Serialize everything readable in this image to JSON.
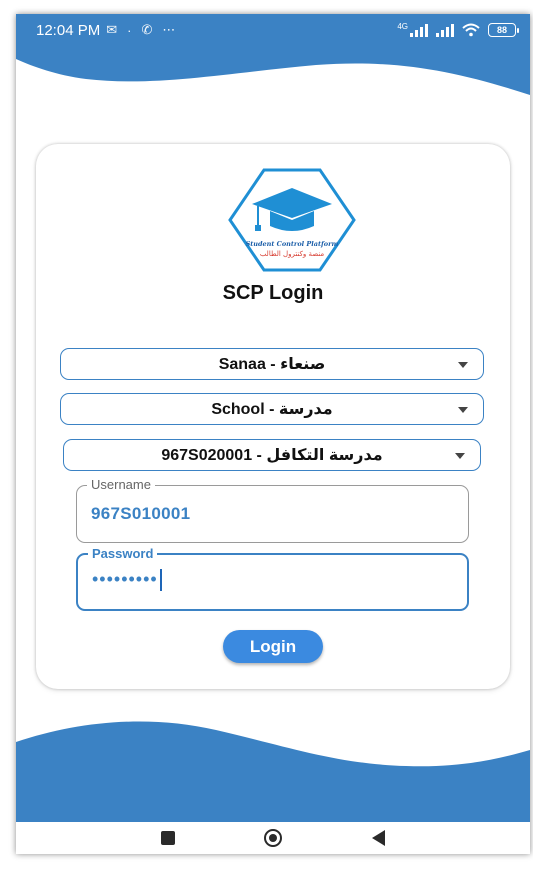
{
  "status_bar": {
    "time": "12:04 PM",
    "left_icons": [
      "mail-icon",
      "dot-icon",
      "whatsapp-icon",
      "more-icon"
    ],
    "network_label": "4G",
    "battery": "88"
  },
  "logo": {
    "text_en": "Student Control Platform",
    "text_ar": "منصة وكنترول الطالب"
  },
  "title": "SCP Login",
  "dropdowns": {
    "governorate": "صنعاء - Sanaa",
    "type": "مدرسة - School",
    "school": "مدرسة التكافل - 967S020001"
  },
  "fields": {
    "username": {
      "label": "Username",
      "value": "967S010001"
    },
    "password": {
      "label": "Password",
      "value": "•••••••••"
    }
  },
  "login_button": "Login",
  "colors": {
    "primary": "#3b82c4",
    "button": "#3b8ae0",
    "logo_red": "#d63a2e"
  },
  "nav": [
    "recents-icon",
    "home-icon",
    "back-icon"
  ]
}
